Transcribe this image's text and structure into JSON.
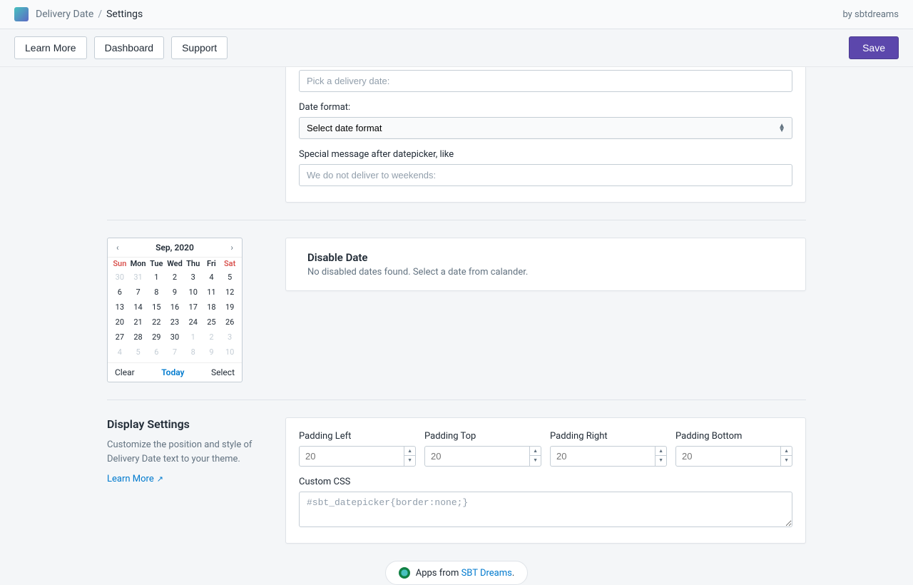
{
  "topbar": {
    "app_name": "Delivery Date",
    "current": "Settings",
    "by": "by sbtdreams"
  },
  "toolbar": {
    "learn_more": "Learn More",
    "dashboard": "Dashboard",
    "support": "Support",
    "save": "Save"
  },
  "form_top": {
    "pick_placeholder": "Pick a delivery date:",
    "date_format_label": "Date format:",
    "date_format_value": "Select date format",
    "special_label": "Special message after datepicker, like",
    "special_placeholder": "We do not deliver to weekends:"
  },
  "calendar": {
    "title": "Sep, 2020",
    "dow": [
      "Sun",
      "Mon",
      "Tue",
      "Wed",
      "Thu",
      "Fri",
      "Sat"
    ],
    "weeks": [
      [
        {
          "d": 30,
          "m": true
        },
        {
          "d": 31,
          "m": true
        },
        {
          "d": 1
        },
        {
          "d": 2
        },
        {
          "d": 3
        },
        {
          "d": 4
        },
        {
          "d": 5
        }
      ],
      [
        {
          "d": 6
        },
        {
          "d": 7
        },
        {
          "d": 8
        },
        {
          "d": 9
        },
        {
          "d": 10
        },
        {
          "d": 11
        },
        {
          "d": 12
        }
      ],
      [
        {
          "d": 13
        },
        {
          "d": 14
        },
        {
          "d": 15
        },
        {
          "d": 16
        },
        {
          "d": 17
        },
        {
          "d": 18
        },
        {
          "d": 19
        }
      ],
      [
        {
          "d": 20
        },
        {
          "d": 21
        },
        {
          "d": 22
        },
        {
          "d": 23
        },
        {
          "d": 24
        },
        {
          "d": 25
        },
        {
          "d": 26
        }
      ],
      [
        {
          "d": 27
        },
        {
          "d": 28
        },
        {
          "d": 29
        },
        {
          "d": 30
        },
        {
          "d": 1,
          "m": true
        },
        {
          "d": 2,
          "m": true
        },
        {
          "d": 3,
          "m": true
        }
      ],
      [
        {
          "d": 4,
          "m": true
        },
        {
          "d": 5,
          "m": true
        },
        {
          "d": 6,
          "m": true
        },
        {
          "d": 7,
          "m": true
        },
        {
          "d": 8,
          "m": true
        },
        {
          "d": 9,
          "m": true
        },
        {
          "d": 10,
          "m": true
        }
      ]
    ],
    "clear": "Clear",
    "today": "Today",
    "select": "Select"
  },
  "disable_date": {
    "title": "Disable Date",
    "desc": "No disabled dates found. Select a date from calander."
  },
  "display": {
    "title": "Display Settings",
    "desc": "Customize the position and style of Delivery Date text to your theme.",
    "learn_more": "Learn More"
  },
  "padding": {
    "left_label": "Padding Left",
    "top_label": "Padding Top",
    "right_label": "Padding Right",
    "bottom_label": "Padding Bottom",
    "placeholder": "20",
    "css_label": "Custom CSS",
    "css_placeholder": "#sbt_datepicker{border:none;}"
  },
  "footer": {
    "prefix": "Apps from ",
    "link": "SBT Dreams",
    "suffix": "."
  }
}
